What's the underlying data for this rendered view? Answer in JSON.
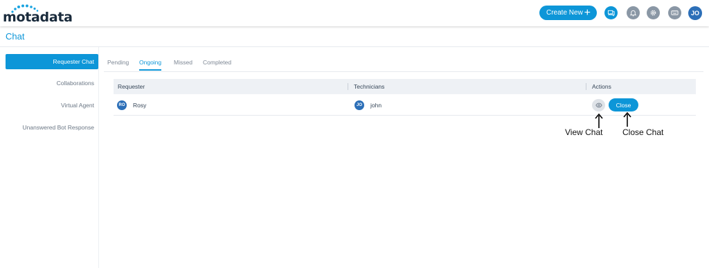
{
  "brand": {
    "name": "motadata",
    "dot_color": "#1aa3e0"
  },
  "header": {
    "create_label": "Create New",
    "create_plus": "+",
    "user_initials": "JO",
    "icons": [
      "chat-icon",
      "bell-icon",
      "gear-icon",
      "keyboard-icon"
    ]
  },
  "page": {
    "title": "Chat"
  },
  "sidebar": {
    "items": [
      {
        "label": "Requester Chat",
        "active": true
      },
      {
        "label": "Collaborations",
        "active": false
      },
      {
        "label": "Virtual Agent",
        "active": false
      },
      {
        "label": "Unanswered Bot Response",
        "active": false
      }
    ]
  },
  "tabs": [
    {
      "label": "Pending",
      "active": false
    },
    {
      "label": "Ongoing",
      "active": true
    },
    {
      "label": "Missed",
      "active": false
    },
    {
      "label": "Completed",
      "active": false
    }
  ],
  "table": {
    "columns": [
      "Requester",
      "Technicians",
      "Actions"
    ],
    "rows": [
      {
        "requester_initials": "RO",
        "requester": "Rosy",
        "technician_initials": "JO",
        "technician": "john",
        "close_label": "Close"
      }
    ]
  },
  "annotations": {
    "view": "View Chat",
    "close": "Close Chat"
  },
  "colors": {
    "accent": "#0d96d8",
    "avatar": "#2c6fb8",
    "muted_icon": "#8a97a5"
  }
}
